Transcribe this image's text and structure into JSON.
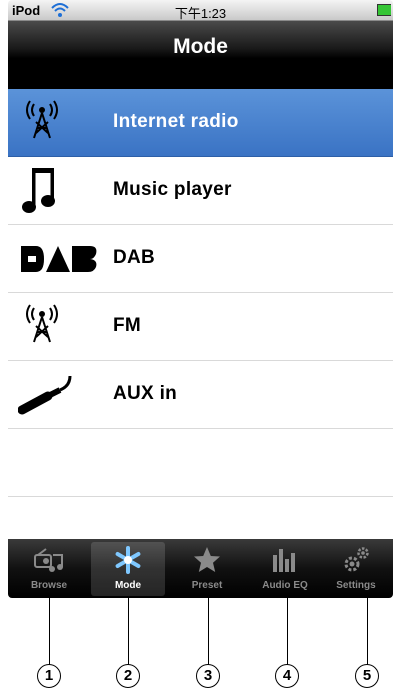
{
  "status_bar": {
    "carrier": "iPod",
    "time": "下午1:23"
  },
  "nav_bar": {
    "title": "Mode"
  },
  "modes": [
    {
      "label": "Internet radio",
      "icon": "antenna-icon",
      "selected": true
    },
    {
      "label": "Music player",
      "icon": "music-note-icon",
      "selected": false
    },
    {
      "label": "DAB",
      "icon": "dab-logo-icon",
      "selected": false
    },
    {
      "label": "FM",
      "icon": "antenna-icon",
      "selected": false
    },
    {
      "label": "AUX in",
      "icon": "aux-cable-icon",
      "selected": false
    }
  ],
  "tabs": [
    {
      "label": "Browse",
      "icon": "radio-music-icon",
      "active": false
    },
    {
      "label": "Mode",
      "icon": "snowflake-icon",
      "active": true
    },
    {
      "label": "Preset",
      "icon": "star-icon",
      "active": false
    },
    {
      "label": "Audio EQ",
      "icon": "equalizer-icon",
      "active": false
    },
    {
      "label": "Settings",
      "icon": "gears-icon",
      "active": false
    }
  ],
  "callouts": [
    "1",
    "2",
    "3",
    "4",
    "5"
  ],
  "colors": {
    "selected_row": "#3a73c4",
    "tab_active_icon": "#7fc8ff",
    "battery": "#35c535"
  }
}
